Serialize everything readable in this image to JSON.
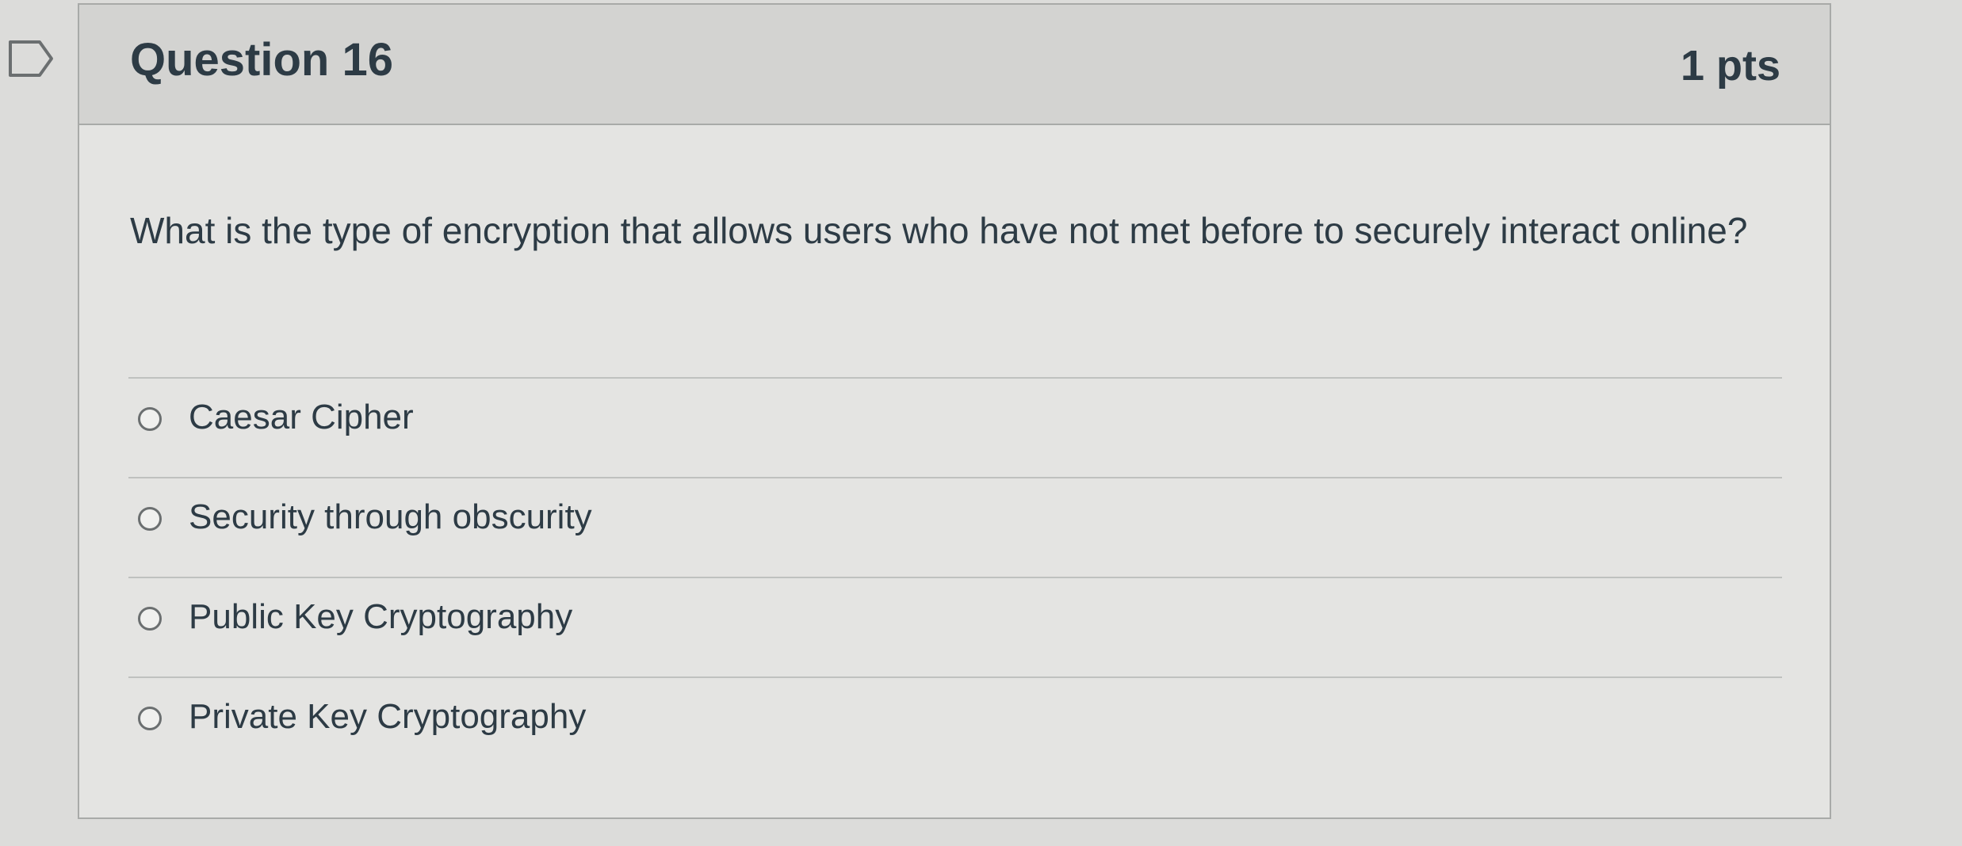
{
  "question": {
    "title": "Question 16",
    "points": "1 pts",
    "text": "What is the type of encryption that allows users who have not met before to securely interact online?",
    "answers": [
      {
        "label": "Caesar Cipher",
        "selected": false
      },
      {
        "label": "Security through obscurity",
        "selected": false
      },
      {
        "label": "Public Key Cryptography",
        "selected": false
      },
      {
        "label": "Private Key Cryptography",
        "selected": false
      }
    ]
  },
  "icons": {
    "flag": "bookmark-flag-icon"
  }
}
